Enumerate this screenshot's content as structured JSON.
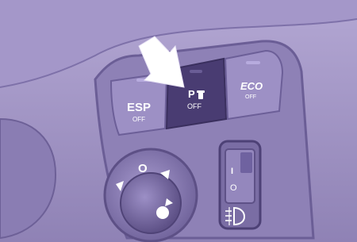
{
  "colors": {
    "background": "#9a8cbe",
    "panel_fill": "#8275ad",
    "panel_outline": "#5f5388",
    "button_light": "#9284bb",
    "button_active": "#4b3f75",
    "arrow": "#ffffff",
    "icon": "#ffffff"
  },
  "buttons": {
    "esp": {
      "label": "ESP",
      "sub": "OFF"
    },
    "park": {
      "label": "P",
      "sub": "OFF"
    },
    "eco": {
      "label": "ECO",
      "sub": "OFF"
    }
  },
  "mirror_knob": {
    "top_label": "O"
  },
  "rocker": {
    "top_label": "I",
    "bottom_label": "O"
  },
  "icons": {
    "arrow": "pointer-arrow",
    "sensor": "park-sensor-icon",
    "fog": "rear-fog-light-icon",
    "triangle": "mirror-direction-triangle"
  }
}
